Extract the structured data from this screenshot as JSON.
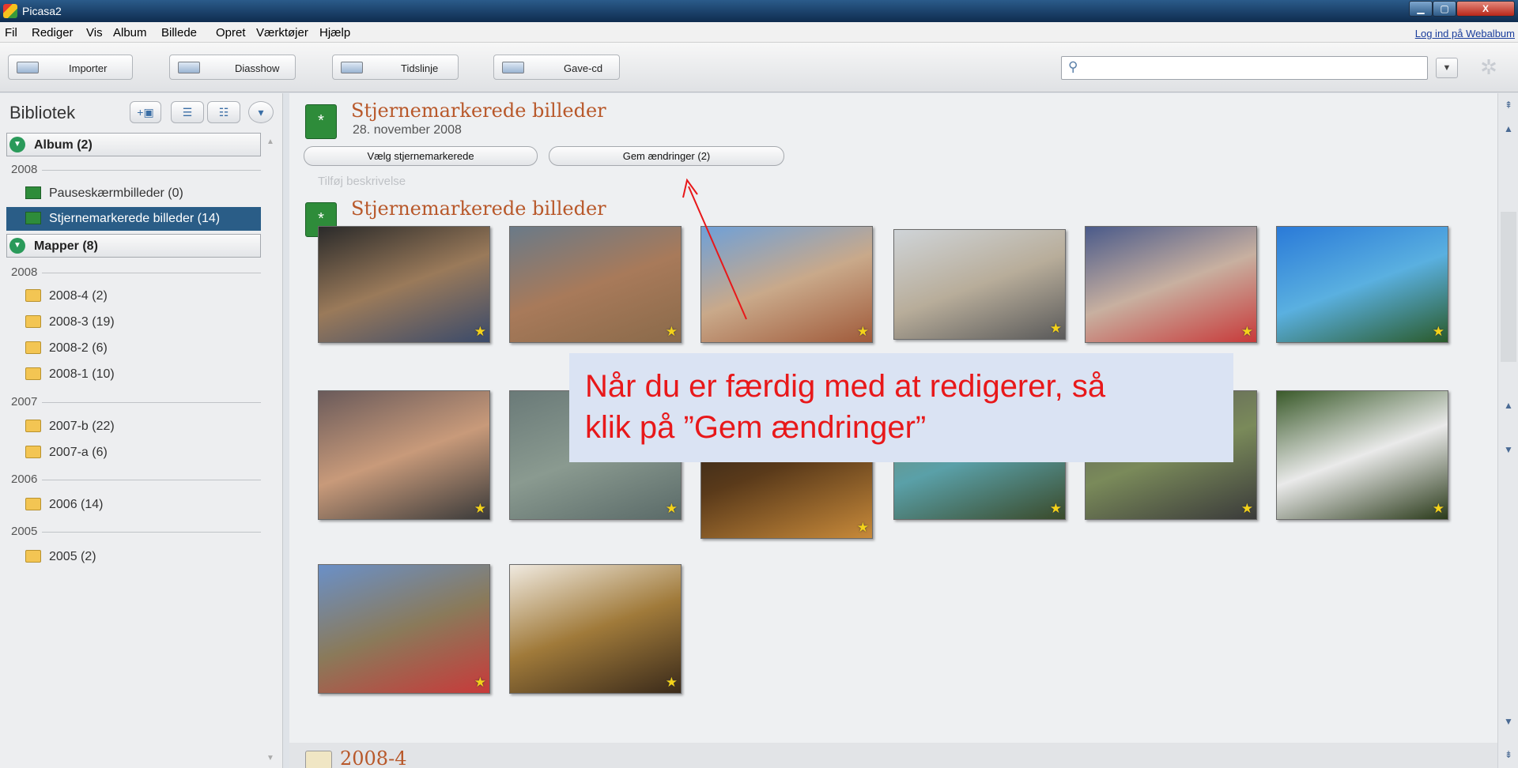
{
  "window": {
    "title": "Picasa2",
    "controls": {
      "minimize": "▁",
      "maximize": "▢",
      "close": "X"
    }
  },
  "menu": {
    "items": [
      "Fil",
      "Rediger",
      "Vis",
      "Album",
      "Billede",
      "Opret",
      "Værktøjer",
      "Hjælp"
    ],
    "login_link": "Log ind på Webalbum"
  },
  "toolbar": {
    "buttons": [
      {
        "label": "Importer",
        "icon": "import-icon"
      },
      {
        "label": "Diasshow",
        "icon": "slideshow-icon"
      },
      {
        "label": "Tidslinje",
        "icon": "timeline-icon"
      },
      {
        "label": "Gave-cd",
        "icon": "gift-cd-icon"
      }
    ],
    "search": {
      "value": "",
      "icon": "search-icon"
    }
  },
  "sidebar": {
    "title": "Bibliotek",
    "album_section": "Album (2)",
    "folders_section": "Mapper (8)",
    "groups": [
      {
        "year": "2008",
        "items": [
          "Pauseskærmbilleder (0)",
          "Stjernemarkerede billeder (14)"
        ]
      },
      {
        "year": "2008",
        "items": [
          "2008-4 (2)",
          "2008-3 (19)",
          "2008-2 (6)",
          "2008-1 (10)"
        ]
      },
      {
        "year": "2007",
        "items": [
          "2007-b (22)",
          "2007-a (6)"
        ]
      },
      {
        "year": "2006",
        "items": [
          "2006 (14)"
        ]
      },
      {
        "year": "2005",
        "items": [
          "2005 (2)"
        ]
      }
    ],
    "selected": "Stjernemarkerede billeder (14)"
  },
  "main": {
    "album_title": "Stjernemarkerede billeder",
    "album_date": "28. november 2008",
    "select_starred_label": "Vælg stjernemarkerede",
    "save_changes_label": "Gem ændringer (2)",
    "description_placeholder": "Tilføj beskrivelse",
    "second_album_title": "Stjernemarkerede billeder",
    "footer_folder": "2008-4",
    "callout_line1": "Når du er færdig med at redigerer, så",
    "callout_line2": "klik på ”Gem ændringer”",
    "photos": [
      {
        "name": "children-photo",
        "starred": true,
        "colors": [
          "#2a2a2a",
          "#9a7a5a",
          "#3a4a6a"
        ]
      },
      {
        "name": "canyon-photo",
        "starred": true,
        "colors": [
          "#6a7a88",
          "#a87a5a",
          "#8a6a4a"
        ]
      },
      {
        "name": "monument-valley-photo",
        "starred": true,
        "colors": [
          "#6ea0d8",
          "#c9a98a",
          "#a05a3a"
        ]
      },
      {
        "name": "desert-road-photo",
        "starred": true,
        "colors": [
          "#cfd4d8",
          "#b8ad9a",
          "#5a5a5a"
        ]
      },
      {
        "name": "girl-reading-photo",
        "starred": true,
        "colors": [
          "#4a5a8a",
          "#c8b0a0",
          "#c83a3a"
        ]
      },
      {
        "name": "boy-on-shoulders-photo",
        "starred": true,
        "colors": [
          "#2a7ad8",
          "#5ab0e0",
          "#2a5a2a"
        ]
      },
      {
        "name": "beach-sunset-photo",
        "starred": true,
        "colors": [
          "#6a5a5a",
          "#c89a7a",
          "#3a3a3a"
        ]
      },
      {
        "name": "jellyfish-photo",
        "starred": true,
        "colors": [
          "#6a7a78",
          "#8a9a90",
          "#5a6a68"
        ]
      },
      {
        "name": "lamp-photo",
        "starred": true,
        "colors": [
          "#1a1a1a",
          "#5a3a1a",
          "#c88a3a"
        ]
      },
      {
        "name": "park-girl-photo",
        "starred": true,
        "colors": [
          "#7a8a6a",
          "#5aa0a8",
          "#3a4a2a"
        ]
      },
      {
        "name": "family-table-photo",
        "starred": true,
        "colors": [
          "#5a5a5a",
          "#7a8a5a",
          "#3a3a3a"
        ]
      },
      {
        "name": "swan-photo",
        "starred": true,
        "colors": [
          "#3a5a2a",
          "#eaeaea",
          "#2a3a1a"
        ]
      },
      {
        "name": "cannon-kids-photo",
        "starred": true,
        "colors": [
          "#6a90c8",
          "#8a7a5a",
          "#c83a3a"
        ]
      },
      {
        "name": "brass-horn-photo",
        "starred": true,
        "colors": [
          "#f0eae0",
          "#a07a3a",
          "#3a2a1a"
        ]
      }
    ]
  }
}
